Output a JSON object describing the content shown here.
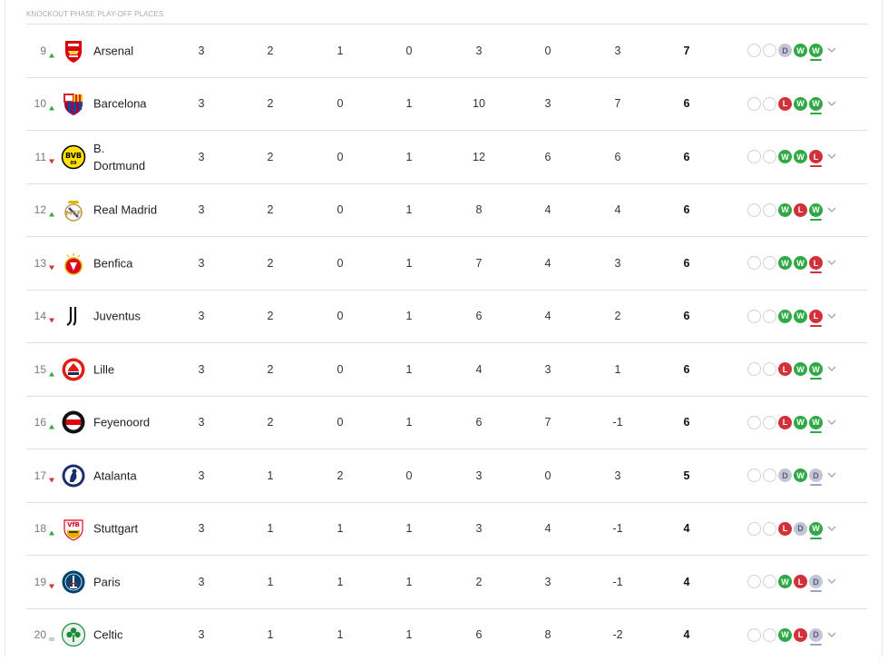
{
  "section_label": "KNOCKOUT PHASE PLAY-OFF PLACES",
  "colors": {
    "up": "#33a84a",
    "down": "#d1323a",
    "same": "#9a9aa6",
    "win": "#2fa845",
    "loss": "#d1323a",
    "draw": "#c3c6d6"
  },
  "rows": [
    {
      "pos": "9",
      "trend": "up",
      "team": "Arsenal",
      "crest_icon": "arsenal-crest-icon",
      "played": "3",
      "won": "2",
      "drawn": "1",
      "lost": "0",
      "gf": "3",
      "ga": "0",
      "gd": "3",
      "pts": "7",
      "form": [
        "",
        "",
        "D",
        "W",
        "W"
      ]
    },
    {
      "pos": "10",
      "trend": "up",
      "team": "Barcelona",
      "crest_icon": "barcelona-crest-icon",
      "played": "3",
      "won": "2",
      "drawn": "0",
      "lost": "1",
      "gf": "10",
      "ga": "3",
      "gd": "7",
      "pts": "6",
      "form": [
        "",
        "",
        "L",
        "W",
        "W"
      ]
    },
    {
      "pos": "11",
      "trend": "down",
      "team": "B. Dortmund",
      "crest_icon": "dortmund-crest-icon",
      "played": "3",
      "won": "2",
      "drawn": "0",
      "lost": "1",
      "gf": "12",
      "ga": "6",
      "gd": "6",
      "pts": "6",
      "form": [
        "",
        "",
        "W",
        "W",
        "L"
      ]
    },
    {
      "pos": "12",
      "trend": "up",
      "team": "Real Madrid",
      "crest_icon": "real-madrid-crest-icon",
      "played": "3",
      "won": "2",
      "drawn": "0",
      "lost": "1",
      "gf": "8",
      "ga": "4",
      "gd": "4",
      "pts": "6",
      "form": [
        "",
        "",
        "W",
        "L",
        "W"
      ]
    },
    {
      "pos": "13",
      "trend": "down",
      "team": "Benfica",
      "crest_icon": "benfica-crest-icon",
      "played": "3",
      "won": "2",
      "drawn": "0",
      "lost": "1",
      "gf": "7",
      "ga": "4",
      "gd": "3",
      "pts": "6",
      "form": [
        "",
        "",
        "W",
        "W",
        "L"
      ]
    },
    {
      "pos": "14",
      "trend": "down",
      "team": "Juventus",
      "crest_icon": "juventus-crest-icon",
      "played": "3",
      "won": "2",
      "drawn": "0",
      "lost": "1",
      "gf": "6",
      "ga": "4",
      "gd": "2",
      "pts": "6",
      "form": [
        "",
        "",
        "W",
        "W",
        "L"
      ]
    },
    {
      "pos": "15",
      "trend": "up",
      "team": "Lille",
      "crest_icon": "lille-crest-icon",
      "played": "3",
      "won": "2",
      "drawn": "0",
      "lost": "1",
      "gf": "4",
      "ga": "3",
      "gd": "1",
      "pts": "6",
      "form": [
        "",
        "",
        "L",
        "W",
        "W"
      ]
    },
    {
      "pos": "16",
      "trend": "up",
      "team": "Feyenoord",
      "crest_icon": "feyenoord-crest-icon",
      "played": "3",
      "won": "2",
      "drawn": "0",
      "lost": "1",
      "gf": "6",
      "ga": "7",
      "gd": "-1",
      "pts": "6",
      "form": [
        "",
        "",
        "L",
        "W",
        "W"
      ]
    },
    {
      "pos": "17",
      "trend": "down",
      "team": "Atalanta",
      "crest_icon": "atalanta-crest-icon",
      "played": "3",
      "won": "1",
      "drawn": "2",
      "lost": "0",
      "gf": "3",
      "ga": "0",
      "gd": "3",
      "pts": "5",
      "form": [
        "",
        "",
        "D",
        "W",
        "D"
      ]
    },
    {
      "pos": "18",
      "trend": "up",
      "team": "Stuttgart",
      "crest_icon": "stuttgart-crest-icon",
      "played": "3",
      "won": "1",
      "drawn": "1",
      "lost": "1",
      "gf": "3",
      "ga": "4",
      "gd": "-1",
      "pts": "4",
      "form": [
        "",
        "",
        "L",
        "D",
        "W"
      ]
    },
    {
      "pos": "19",
      "trend": "down",
      "team": "Paris",
      "crest_icon": "psg-crest-icon",
      "played": "3",
      "won": "1",
      "drawn": "1",
      "lost": "1",
      "gf": "2",
      "ga": "3",
      "gd": "-1",
      "pts": "4",
      "form": [
        "",
        "",
        "W",
        "L",
        "D"
      ]
    },
    {
      "pos": "20",
      "trend": "same",
      "team": "Celtic",
      "crest_icon": "celtic-crest-icon",
      "played": "3",
      "won": "1",
      "drawn": "1",
      "lost": "1",
      "gf": "6",
      "ga": "8",
      "gd": "-2",
      "pts": "4",
      "form": [
        "",
        "",
        "W",
        "L",
        "D"
      ]
    }
  ]
}
